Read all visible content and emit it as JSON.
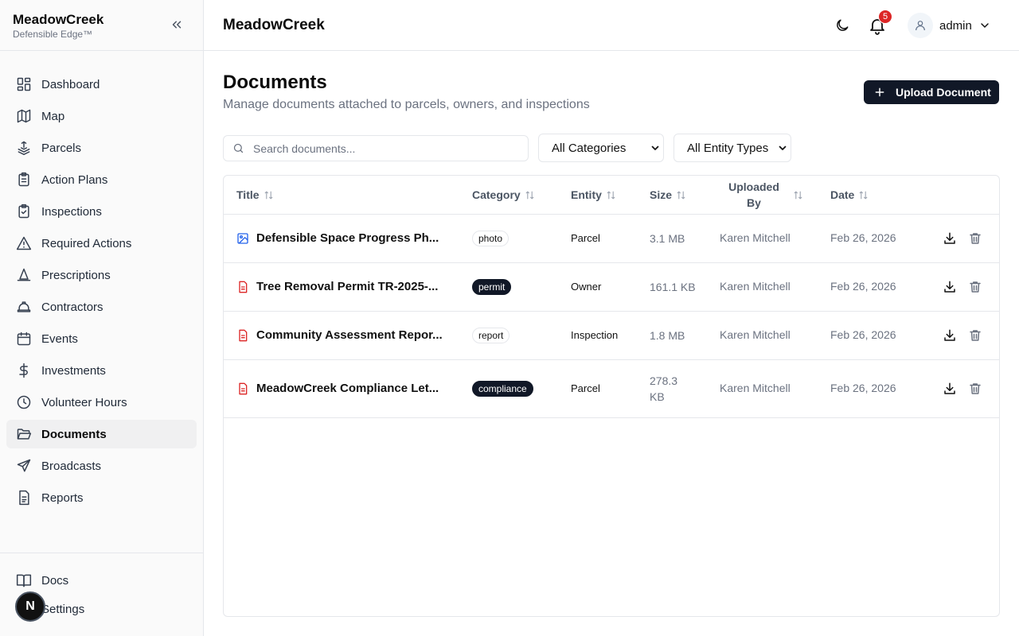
{
  "brand": {
    "name": "MeadowCreek",
    "tagline": "Defensible Edge™"
  },
  "sidebar": {
    "items": [
      {
        "label": "Dashboard",
        "icon": "dashboard-icon"
      },
      {
        "label": "Map",
        "icon": "map-icon"
      },
      {
        "label": "Parcels",
        "icon": "parcels-icon"
      },
      {
        "label": "Action Plans",
        "icon": "clipboard-icon"
      },
      {
        "label": "Inspections",
        "icon": "clipboard-check-icon"
      },
      {
        "label": "Required Actions",
        "icon": "alert-triangle-icon"
      },
      {
        "label": "Prescriptions",
        "icon": "cone-icon"
      },
      {
        "label": "Contractors",
        "icon": "hard-hat-icon"
      },
      {
        "label": "Events",
        "icon": "calendar-icon"
      },
      {
        "label": "Investments",
        "icon": "dollar-icon"
      },
      {
        "label": "Volunteer Hours",
        "icon": "clock-icon"
      },
      {
        "label": "Documents",
        "icon": "folder-open-icon",
        "active": true
      },
      {
        "label": "Broadcasts",
        "icon": "send-icon"
      },
      {
        "label": "Reports",
        "icon": "file-text-icon"
      }
    ],
    "footer": [
      {
        "label": "Docs",
        "icon": "book-icon"
      },
      {
        "label": "Settings",
        "icon": "settings-icon"
      }
    ],
    "fab_letter": "N"
  },
  "header": {
    "title": "MeadowCreek",
    "notifications_count": "5",
    "user": "admin"
  },
  "page": {
    "title": "Documents",
    "subtitle": "Manage documents attached to parcels, owners, and inspections",
    "upload_label": "Upload Document"
  },
  "filters": {
    "search_placeholder": "Search documents...",
    "category": "All Categories",
    "entity_type": "All Entity Types"
  },
  "table": {
    "columns": {
      "title": "Title",
      "category": "Category",
      "entity": "Entity",
      "size": "Size",
      "uploaded_by": "Uploaded By",
      "date": "Date"
    },
    "rows": [
      {
        "title": "Defensible Space Progress Ph...",
        "file_icon": "image-file-icon",
        "category": "photo",
        "category_style": "outline",
        "entity": "Parcel",
        "size": "3.1 MB",
        "uploaded_by": "Karen Mitchell",
        "date": "Feb 26, 2026"
      },
      {
        "title": "Tree Removal Permit TR-2025-...",
        "file_icon": "document-file-icon",
        "category": "permit",
        "category_style": "solid",
        "entity": "Owner",
        "size": "161.1 KB",
        "uploaded_by": "Karen Mitchell",
        "date": "Feb 26, 2026"
      },
      {
        "title": "Community Assessment Repor...",
        "file_icon": "document-file-icon",
        "category": "report",
        "category_style": "outline",
        "entity": "Inspection",
        "size": "1.8 MB",
        "uploaded_by": "Karen Mitchell",
        "date": "Feb 26, 2026"
      },
      {
        "title": "MeadowCreek Compliance Let...",
        "file_icon": "document-file-icon",
        "category": "compliance",
        "category_style": "solid",
        "entity": "Parcel",
        "size": "278.3 KB",
        "uploaded_by": "Karen Mitchell",
        "date": "Feb 26, 2026"
      }
    ]
  },
  "colors": {
    "primary": "#111827",
    "badge_red": "#dc2626",
    "file_red": "#dc2626",
    "file_blue": "#2563eb",
    "muted": "#6b7280"
  }
}
